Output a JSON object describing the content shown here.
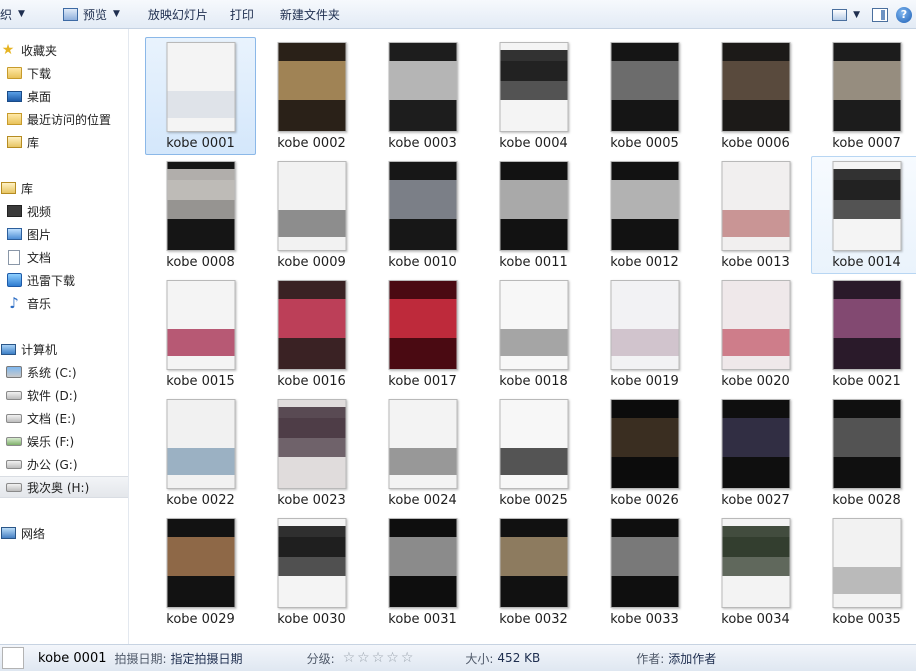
{
  "toolbar": {
    "organize": "织",
    "preview": "预览",
    "slideshow": "放映幻灯片",
    "print": "打印",
    "new_folder": "新建文件夹",
    "help": "?"
  },
  "sidebar": {
    "favorites_header": "收藏夹",
    "favorites": [
      "下载",
      "桌面",
      "最近访问的位置"
    ],
    "favorites_lib": "库",
    "libraries_header": "库",
    "libraries": [
      "视频",
      "图片",
      "文档",
      "迅雷下载",
      "音乐"
    ],
    "computer_header": "计算机",
    "drives": [
      "系统 (C:)",
      "软件 (D:)",
      "文档 (E:)",
      "娱乐 (F:)",
      "办公 (G:)",
      "我次奥 (H:)"
    ],
    "network": "网络"
  },
  "files": [
    "kobe 0001",
    "kobe 0002",
    "kobe 0003",
    "kobe 0004",
    "kobe 0005",
    "kobe 0006",
    "kobe 0007",
    "kobe 0008",
    "kobe 0009",
    "kobe 0010",
    "kobe 0011",
    "kobe 0012",
    "kobe 0013",
    "kobe 0014",
    "kobe 0015",
    "kobe 0016",
    "kobe 0017",
    "kobe 0018",
    "kobe 0019",
    "kobe 0020",
    "kobe 0021",
    "kobe 0022",
    "kobe 0023",
    "kobe 0024",
    "kobe 0025",
    "kobe 0026",
    "kobe 0027",
    "kobe 0028",
    "kobe 0029",
    "kobe 0030",
    "kobe 0031",
    "kobe 0032",
    "kobe 0033",
    "kobe 0034",
    "kobe 0035"
  ],
  "status": {
    "name": "kobe 0001",
    "date_key": "拍摄日期:",
    "date_val": "指定拍摄日期",
    "rating_key": "分级:",
    "size_key": "大小:",
    "size_val": "452 KB",
    "author_key": "作者:",
    "author_val": "添加作者"
  }
}
